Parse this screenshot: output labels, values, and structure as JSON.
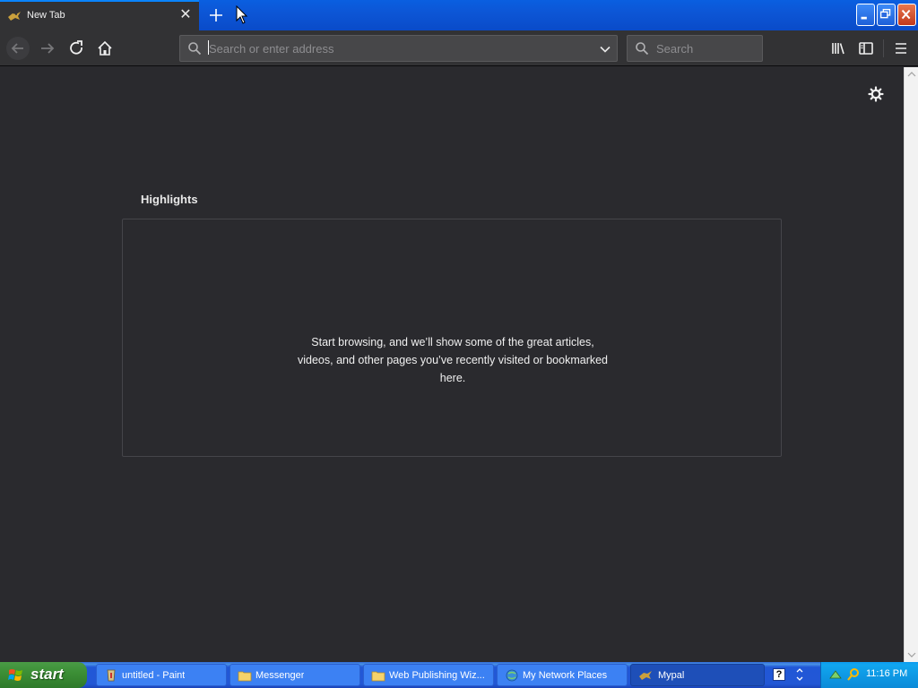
{
  "tab": {
    "title": "New Tab"
  },
  "urlbar": {
    "placeholder": "Search or enter address"
  },
  "searchbar": {
    "placeholder": "Search"
  },
  "highlights": {
    "title": "Highlights",
    "empty_message": "Start browsing, and we’ll show some of the great articles, videos, and other pages you’ve recently visited or bookmarked here."
  },
  "taskbar": {
    "start_label": "start",
    "items": [
      {
        "label": "untitled - Paint",
        "icon": "paint-icon"
      },
      {
        "label": "Messenger",
        "icon": "folder-icon"
      },
      {
        "label": "Web Publishing Wiz...",
        "icon": "folder-icon"
      },
      {
        "label": "My Network Places",
        "icon": "network-places-icon"
      },
      {
        "label": "Mypal",
        "icon": "mypal-icon",
        "active": true
      }
    ],
    "help_glyph": "?",
    "clock": "11:16 PM"
  },
  "colors": {
    "accent": "#0a84ff",
    "content_bg": "#2a2a2e",
    "toolbar_bg": "#323234",
    "taskbar_blue": "#2257d5",
    "start_green": "#3c8f36"
  }
}
